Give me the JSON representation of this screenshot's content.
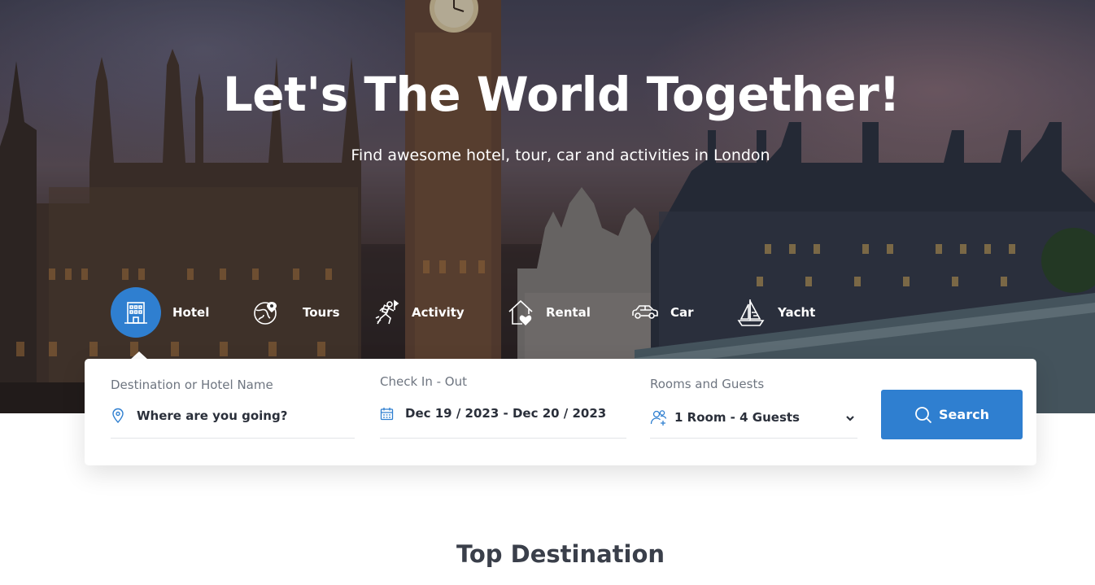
{
  "hero": {
    "title": "Let's The World Together!",
    "subtitle": "Find awesome hotel, tour, car and activities in London"
  },
  "tabs": [
    {
      "label": "Hotel",
      "icon": "hotel-icon",
      "active": true
    },
    {
      "label": "Tours",
      "icon": "globe-pin-icon",
      "active": false
    },
    {
      "label": "Activity",
      "icon": "climber-icon",
      "active": false
    },
    {
      "label": "Rental",
      "icon": "house-heart-icon",
      "active": false
    },
    {
      "label": "Car",
      "icon": "car-icon",
      "active": false
    },
    {
      "label": "Yacht",
      "icon": "sailboat-icon",
      "active": false
    }
  ],
  "search": {
    "destination": {
      "label": "Destination or Hotel Name",
      "value": "Where are you going?",
      "icon": "map-pin-icon"
    },
    "dates": {
      "label": "Check In - Out",
      "value": "Dec 19 / 2023 - Dec 20 / 2023",
      "icon": "calendar-icon"
    },
    "guests": {
      "label": "Rooms and Guests",
      "value": "1 Room - 4 Guests",
      "icon": "add-users-icon"
    },
    "button_label": "Search"
  },
  "section": {
    "title": "Top Destination"
  },
  "colors": {
    "accent": "#2f7fd0",
    "text_dark": "#2a2f3a",
    "label_gray": "#6e7580"
  }
}
